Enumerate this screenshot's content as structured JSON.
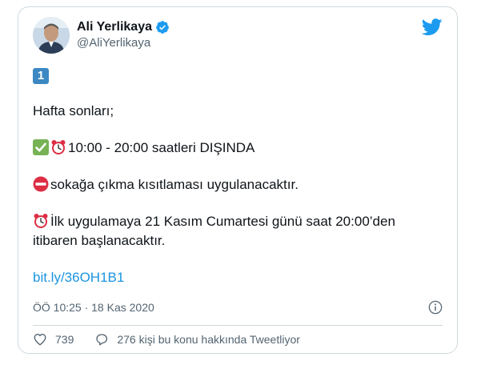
{
  "author": {
    "display_name": "Ali Yerlikaya",
    "handle": "@AliYerlikaya",
    "verified": true
  },
  "tweet": {
    "keycap": "1",
    "line_intro": "Hafta sonları;",
    "line_hours": "10:00 - 20:00 saatleri DIŞINDA",
    "line_curfew": "sokağa çıkma kısıtlaması uygulanacaktır.",
    "line_start_1": "İlk uygulamaya 21 Kasım Cumartesi günü saat 20:00’den",
    "line_start_2": "itibaren başlanacaktır.",
    "link_text": "bit.ly/36OH1B1"
  },
  "timestamp": "ÖÖ 10:25 · 18 Kas 2020",
  "actions": {
    "likes": "739",
    "reply_text": "276 kişi bu konu hakkında Tweetliyor"
  },
  "icons": {
    "brand": "twitter-bird-icon",
    "verified": "verified-badge-icon",
    "check": "check-mark-emoji-icon",
    "alarm": "alarm-clock-emoji-icon",
    "no_entry": "no-entry-emoji-icon",
    "info": "info-icon",
    "like": "heart-icon",
    "reply": "reply-bubble-icon"
  },
  "colors": {
    "brand_blue": "#1d9bf0",
    "link_blue": "#1b95e0",
    "text": "#0f1419",
    "muted": "#536471",
    "border": "#cfd9de"
  }
}
